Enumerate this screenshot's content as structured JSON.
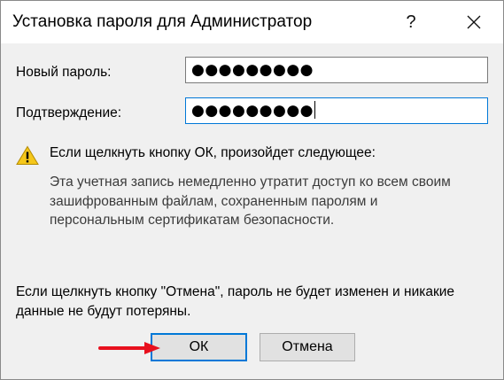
{
  "dialog": {
    "title": "Установка пароля для Администратор",
    "help_label": "?"
  },
  "form": {
    "new_password_label": "Новый пароль:",
    "new_password_value": "●●●●●●●●●",
    "confirm_label": "Подтверждение:",
    "confirm_value": "●●●●●●●●●"
  },
  "warning": {
    "heading": "Если щелкнуть кнопку ОК, произойдет следующее:",
    "details": [
      "Эта учетная запись немедленно утратит доступ ко всем своим",
      "зашифрованным файлам, сохраненным паролям и",
      "персональным сертификатам безопасности."
    ],
    "cancel_note": [
      "Если щелкнуть кнопку \"Отмена\", пароль не будет изменен и никакие",
      "данные не будут потеряны."
    ]
  },
  "buttons": {
    "ok_label": "ОК",
    "cancel_label": "Отмена"
  },
  "colors": {
    "focus_accent": "#0078d7",
    "warning_yellow": "#f5c71a",
    "annotation_arrow": "#e8101e"
  },
  "icons": {
    "warning": "warning-triangle-icon",
    "close": "close-icon",
    "arrow": "red-arrow-icon"
  }
}
